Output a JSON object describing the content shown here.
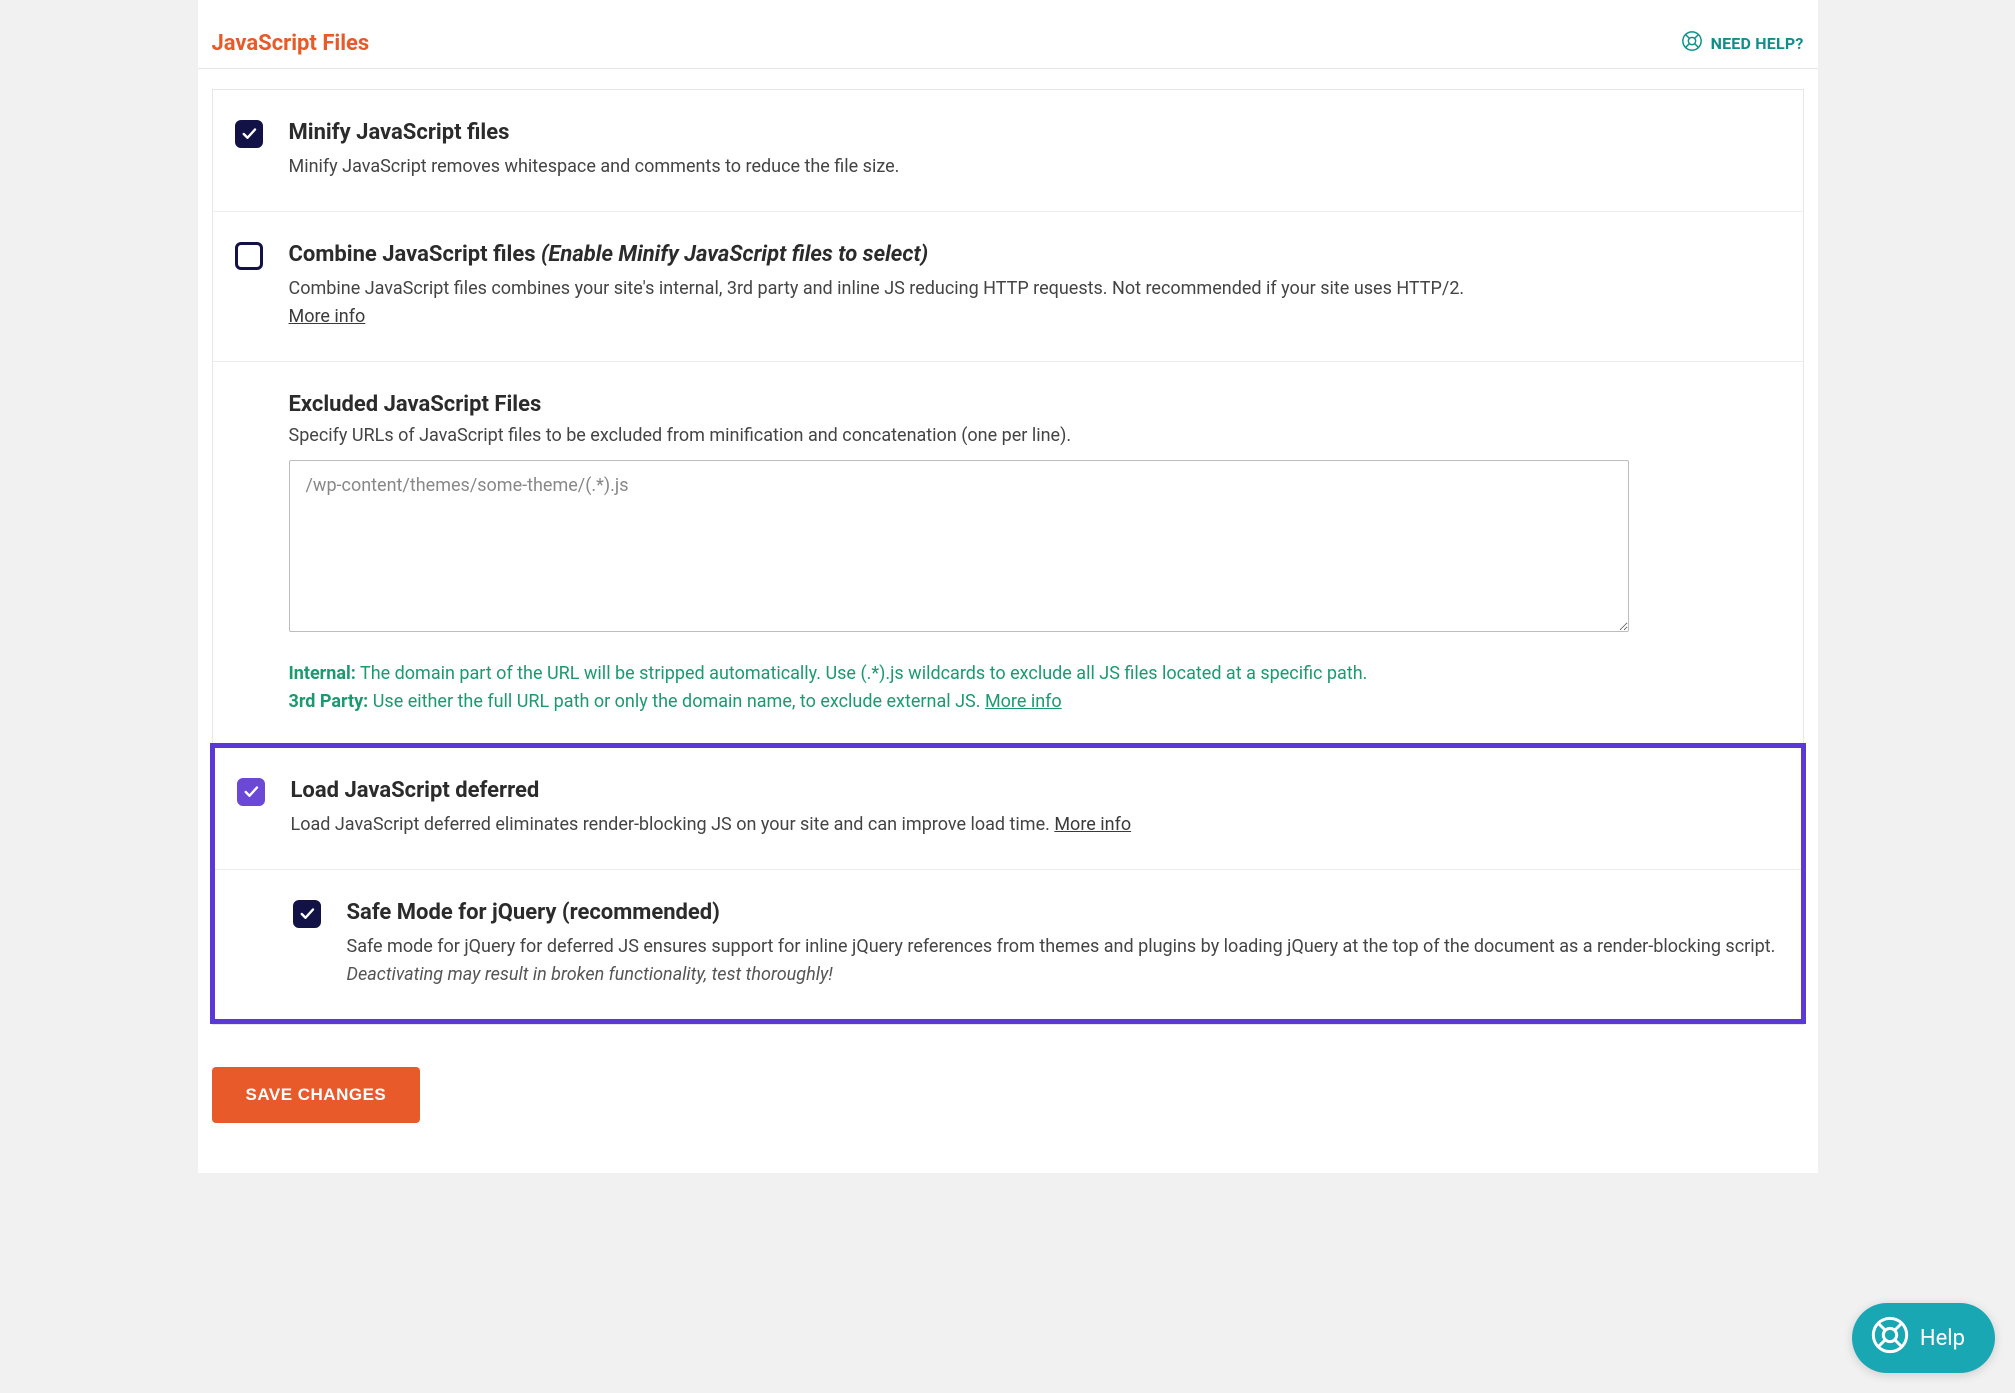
{
  "header": {
    "title": "JavaScript Files",
    "help_label": "NEED HELP?"
  },
  "options": {
    "minify": {
      "checked": true,
      "title": "Minify JavaScript files",
      "desc": "Minify JavaScript removes whitespace and comments to reduce the file size."
    },
    "combine": {
      "checked": false,
      "title": "Combine JavaScript files",
      "hint": "(Enable Minify JavaScript files to select)",
      "desc": "Combine JavaScript files combines your site's internal, 3rd party and inline JS reducing HTTP requests. Not recommended if your site uses HTTP/2.",
      "more": "More info"
    },
    "excluded": {
      "title": "Excluded JavaScript Files",
      "desc": "Specify URLs of JavaScript files to be excluded from minification and concatenation (one per line).",
      "placeholder": "/wp-content/themes/some-theme/(.*).js",
      "internal_label": "Internal:",
      "internal_text": "The domain part of the URL will be stripped automatically. Use (.*).js wildcards to exclude all JS files located at a specific path.",
      "third_label": "3rd Party:",
      "third_text": "Use either the full URL path or only the domain name, to exclude external JS.",
      "more": "More info"
    },
    "defer": {
      "checked": true,
      "title": "Load JavaScript deferred",
      "desc": "Load JavaScript deferred eliminates render-blocking JS on your site and can improve load time.",
      "more": "More info"
    },
    "safe_mode": {
      "checked": true,
      "title": "Safe Mode for jQuery (recommended)",
      "desc": "Safe mode for jQuery for deferred JS ensures support for inline jQuery references from themes and plugins by loading jQuery at the top of the document as a render-blocking script.",
      "warning": "Deactivating may result in broken functionality, test thoroughly!"
    }
  },
  "save_label": "SAVE CHANGES",
  "bubble_label": "Help"
}
